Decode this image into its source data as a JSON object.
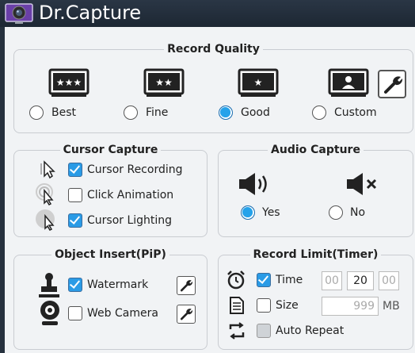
{
  "app": {
    "title": "Dr.Capture"
  },
  "record_quality": {
    "title": "Record Quality",
    "options": [
      {
        "label": "Best",
        "selected": false,
        "icon": "three-star-monitor-icon"
      },
      {
        "label": "Fine",
        "selected": false,
        "icon": "two-star-monitor-icon"
      },
      {
        "label": "Good",
        "selected": true,
        "icon": "one-star-monitor-icon"
      },
      {
        "label": "Custom",
        "selected": false,
        "icon": "person-monitor-icon"
      }
    ]
  },
  "cursor_capture": {
    "title": "Cursor Capture",
    "items": [
      {
        "label": "Cursor Recording",
        "checked": true
      },
      {
        "label": "Click Animation",
        "checked": false
      },
      {
        "label": "Cursor Lighting",
        "checked": true
      }
    ]
  },
  "audio_capture": {
    "title": "Audio Capture",
    "yes_label": "Yes",
    "no_label": "No",
    "selected": "Yes"
  },
  "object_insert": {
    "title": "Object Insert(PiP)",
    "items": [
      {
        "label": "Watermark",
        "checked": true
      },
      {
        "label": "Web Camera",
        "checked": false
      }
    ]
  },
  "record_limit": {
    "title": "Record Limit(Timer)",
    "time_label": "Time",
    "time_checked": true,
    "hours": "00",
    "minutes": "20",
    "seconds": "00",
    "size_label": "Size",
    "size_checked": false,
    "size_value": "999",
    "size_unit": "MB",
    "repeat_label": "Auto Repeat",
    "repeat_checked": false
  },
  "colors": {
    "accent": "#2a9be6",
    "titlebar": "#1d2733",
    "panel": "#f1f3f5"
  }
}
